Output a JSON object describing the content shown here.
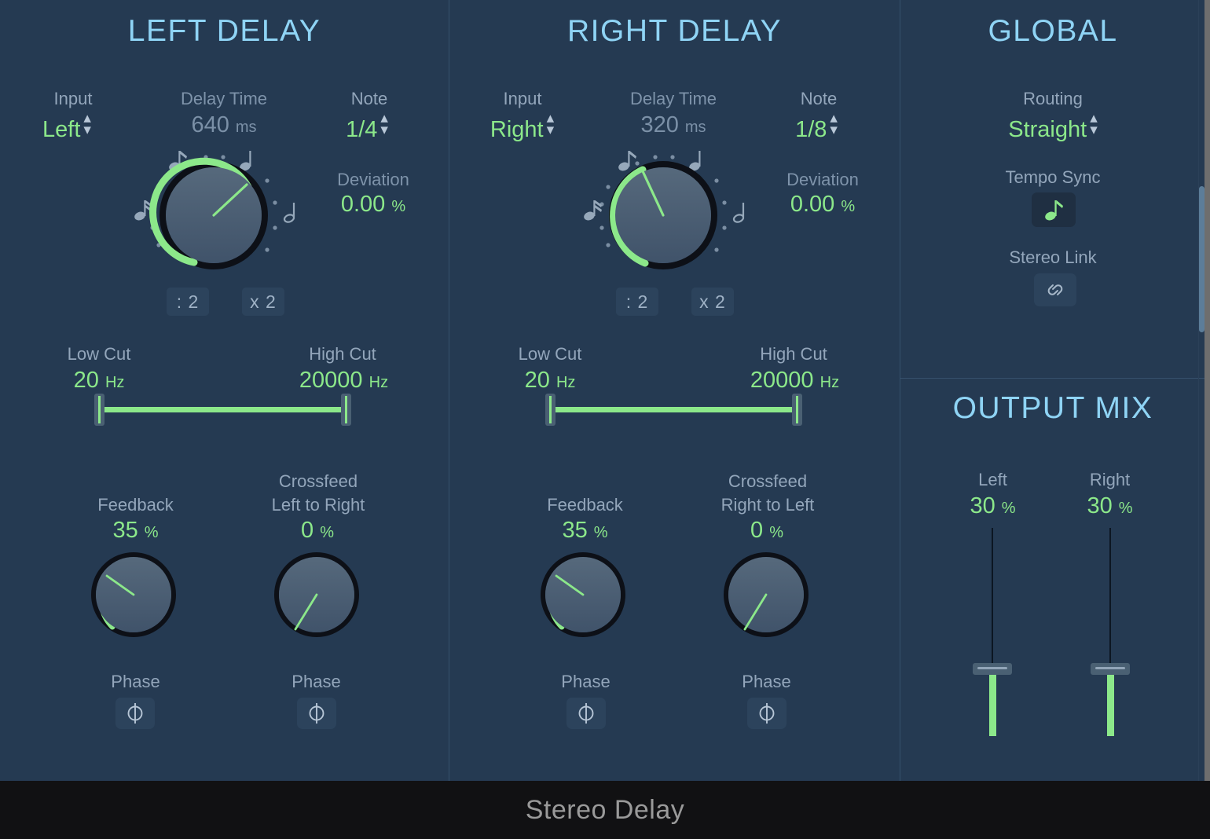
{
  "window": {
    "title": "Stereo Delay"
  },
  "colors": {
    "background": "#253a52",
    "accent_green": "#8ce88a",
    "title_blue": "#8fd4f5",
    "label_gray": "#93a6bb",
    "knob_face": "#4b5e70"
  },
  "left_delay": {
    "title": "LEFT DELAY",
    "input": {
      "label": "Input",
      "value": "Left"
    },
    "delay_time": {
      "label": "Delay Time",
      "value": "640",
      "unit": "ms"
    },
    "note": {
      "label": "Note",
      "value": "1/4"
    },
    "deviation": {
      "label": "Deviation",
      "value": "0.00",
      "unit": "%"
    },
    "halve_button": ": 2",
    "double_button": "x 2",
    "low_cut": {
      "label": "Low Cut",
      "value": "20",
      "unit": "Hz"
    },
    "high_cut": {
      "label": "High Cut",
      "value": "20000",
      "unit": "Hz"
    },
    "feedback": {
      "label": "Feedback",
      "value": "35",
      "unit": "%",
      "phase_label": "Phase"
    },
    "crossfeed": {
      "label": "Crossfeed",
      "label2": "Left to Right",
      "value": "0",
      "unit": "%",
      "phase_label": "Phase"
    }
  },
  "right_delay": {
    "title": "RIGHT DELAY",
    "input": {
      "label": "Input",
      "value": "Right"
    },
    "delay_time": {
      "label": "Delay Time",
      "value": "320",
      "unit": "ms"
    },
    "note": {
      "label": "Note",
      "value": "1/8"
    },
    "deviation": {
      "label": "Deviation",
      "value": "0.00",
      "unit": "%"
    },
    "halve_button": ": 2",
    "double_button": "x 2",
    "low_cut": {
      "label": "Low Cut",
      "value": "20",
      "unit": "Hz"
    },
    "high_cut": {
      "label": "High Cut",
      "value": "20000",
      "unit": "Hz"
    },
    "feedback": {
      "label": "Feedback",
      "value": "35",
      "unit": "%",
      "phase_label": "Phase"
    },
    "crossfeed": {
      "label": "Crossfeed",
      "label2": "Right to Left",
      "value": "0",
      "unit": "%",
      "phase_label": "Phase"
    }
  },
  "global": {
    "title": "GLOBAL",
    "routing": {
      "label": "Routing",
      "value": "Straight"
    },
    "tempo_sync": {
      "label": "Tempo Sync",
      "icon": "eighth-note-icon",
      "state": "on"
    },
    "stereo_link": {
      "label": "Stereo Link",
      "icon": "chain-link-icon",
      "state": "off"
    }
  },
  "output_mix": {
    "title": "OUTPUT MIX",
    "left": {
      "label": "Left",
      "value": "30",
      "unit": "%"
    },
    "right": {
      "label": "Right",
      "value": "30",
      "unit": "%"
    }
  },
  "chart_data": {
    "type": "table",
    "title": "Stereo Delay parameter state",
    "categories": [
      "Left Delay",
      "Right Delay"
    ],
    "series": [
      {
        "name": "Delay Time (ms)",
        "values": [
          640,
          320
        ]
      },
      {
        "name": "Deviation (%)",
        "values": [
          0.0,
          0.0
        ]
      },
      {
        "name": "Low Cut (Hz)",
        "values": [
          20,
          20
        ]
      },
      {
        "name": "High Cut (Hz)",
        "values": [
          20000,
          20000
        ]
      },
      {
        "name": "Feedback (%)",
        "values": [
          35,
          35
        ]
      },
      {
        "name": "Crossfeed (%)",
        "values": [
          0,
          0
        ]
      },
      {
        "name": "Output Mix (%)",
        "values": [
          30,
          30
        ]
      }
    ]
  }
}
